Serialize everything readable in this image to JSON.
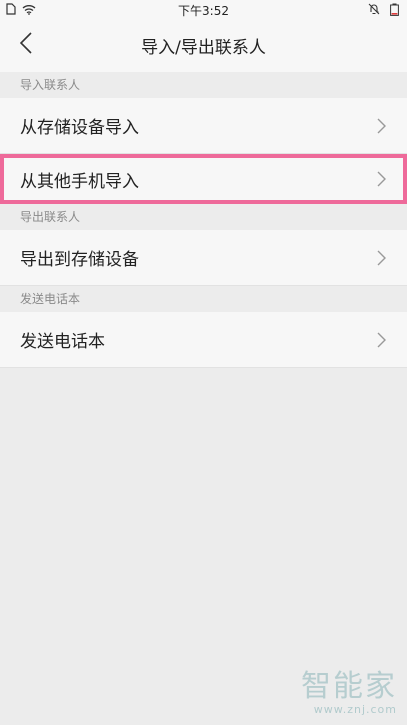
{
  "status_bar": {
    "time": "下午3:52"
  },
  "nav": {
    "title": "导入/导出联系人"
  },
  "sections": [
    {
      "header": "导入联系人",
      "items": [
        "从存储设备导入",
        "从其他手机导入"
      ]
    },
    {
      "header": "导出联系人",
      "items": [
        "导出到存储设备"
      ]
    },
    {
      "header": "发送电话本",
      "items": [
        "发送电话本"
      ]
    }
  ],
  "watermark": {
    "logo": "智能家",
    "url": "www.znj.com"
  },
  "colors": {
    "highlight": "#ee6a9a",
    "background": "#ececec",
    "row": "#f7f7f7"
  }
}
